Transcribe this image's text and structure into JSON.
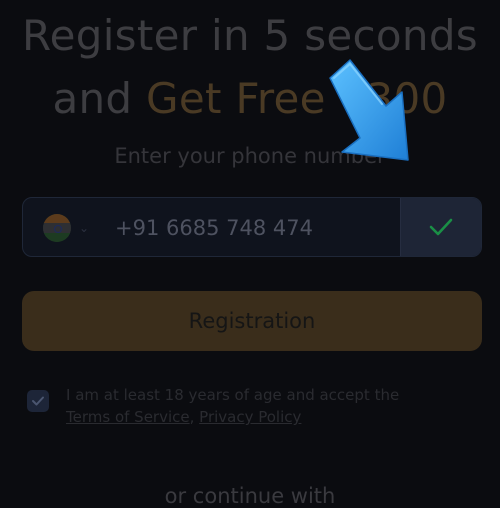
{
  "header": {
    "title_line1": "Register in 5 seconds",
    "title_line2_prefix": "and",
    "title_line2_accent": "Get Free ₹300",
    "subtitle": "Enter your phone number"
  },
  "phone": {
    "country_flag": "india-flag-icon",
    "value": "+91 6685 748 474"
  },
  "register_button": {
    "label": "Registration"
  },
  "consent": {
    "checked": true,
    "text": "I am at least 18 years of age and accept the",
    "terms_link": "Terms of Service",
    "separator": ",",
    "privacy_link": "Privacy Policy"
  },
  "footer": {
    "continue_text": "or continue with"
  },
  "colors": {
    "background": "#0b0c10",
    "accent": "#f5a742",
    "check": "#22c55e",
    "arrow": "#2d9cf0"
  }
}
